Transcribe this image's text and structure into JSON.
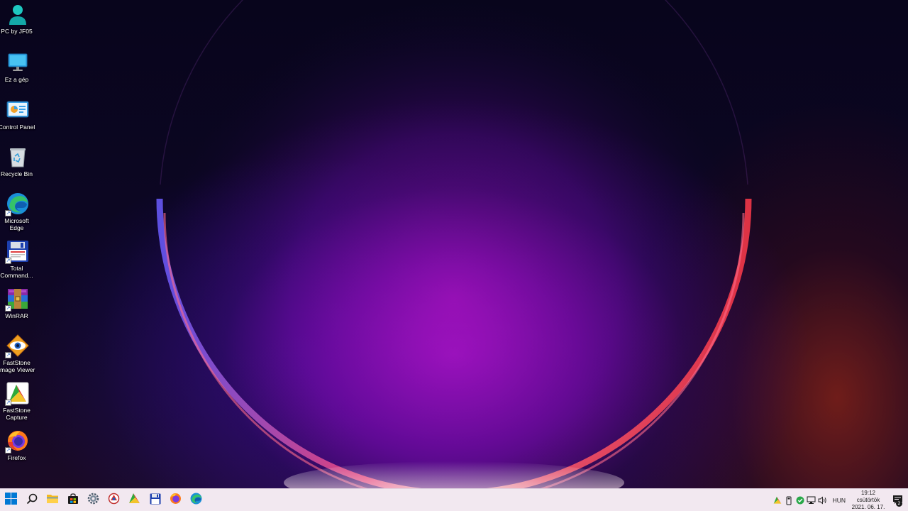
{
  "desktop": {
    "icons": [
      {
        "label": "PC by JF05",
        "icon": "user-icon",
        "shortcut": false
      },
      {
        "label": "Ez a gép",
        "icon": "monitor-icon",
        "shortcut": false
      },
      {
        "label": "Control Panel",
        "icon": "control-panel-icon",
        "shortcut": false
      },
      {
        "label": "Recycle Bin",
        "icon": "recycle-bin-icon",
        "shortcut": false
      },
      {
        "label": "Microsoft Edge",
        "icon": "edge-icon",
        "shortcut": true
      },
      {
        "label": "Total Command...",
        "icon": "total-commander-icon",
        "shortcut": true
      },
      {
        "label": "WinRAR",
        "icon": "winrar-icon",
        "shortcut": true
      },
      {
        "label": "FastStone Image Viewer",
        "icon": "faststone-viewer-icon",
        "shortcut": true
      },
      {
        "label": "FastStone Capture",
        "icon": "faststone-capture-icon",
        "shortcut": true
      },
      {
        "label": "Firefox",
        "icon": "firefox-icon",
        "shortcut": true
      }
    ]
  },
  "taskbar": {
    "pinned": [
      {
        "name": "start-button",
        "icon": "windows-logo-icon"
      },
      {
        "name": "search-button",
        "icon": "search-icon"
      },
      {
        "name": "file-explorer-button",
        "icon": "folder-icon"
      },
      {
        "name": "store-button",
        "icon": "store-icon"
      },
      {
        "name": "settings-button",
        "icon": "gear-icon"
      },
      {
        "name": "faststone-viewer-button",
        "icon": "faststone-viewer-icon"
      },
      {
        "name": "faststone-capture-button",
        "icon": "faststone-capture-icon"
      },
      {
        "name": "total-commander-button",
        "icon": "floppy-icon"
      },
      {
        "name": "firefox-button",
        "icon": "firefox-icon"
      },
      {
        "name": "edge-button",
        "icon": "edge-icon"
      }
    ],
    "tray": {
      "language": "HUN",
      "time": "19:12",
      "day": "csütörtök",
      "date": "2021. 06. 17.",
      "notification_count": "2"
    }
  },
  "colors": {
    "taskbar_bg": "#f2e8f0",
    "accent": "#0078d4"
  }
}
